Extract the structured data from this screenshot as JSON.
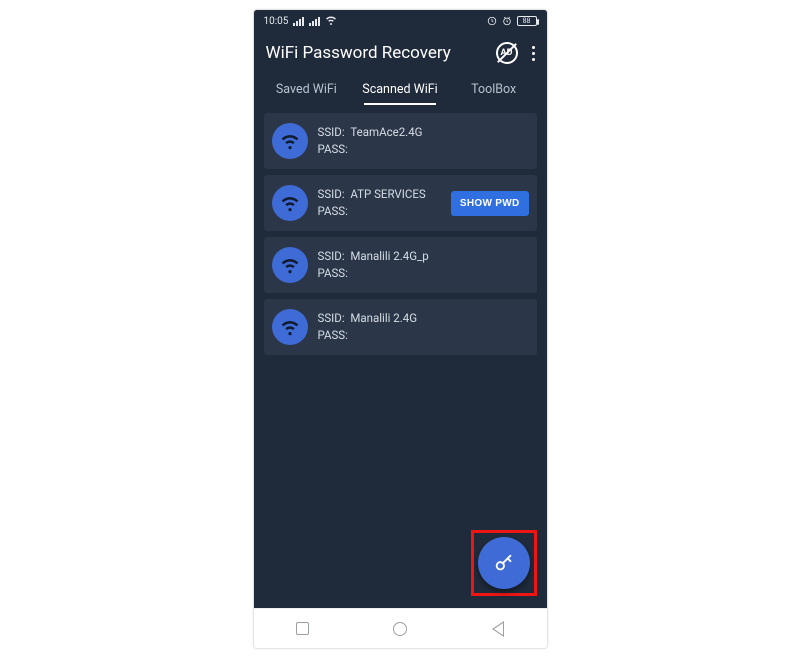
{
  "status": {
    "time": "10:05",
    "battery": "88"
  },
  "header": {
    "title": "WiFi Password Recovery",
    "ad_label": "AD"
  },
  "tabs": [
    {
      "label": "Saved WiFi",
      "active": false
    },
    {
      "label": "Scanned WiFi",
      "active": true
    },
    {
      "label": "ToolBox",
      "active": false
    }
  ],
  "labels": {
    "ssid_prefix": "SSID:",
    "pass_prefix": "PASS:",
    "show_button": "SHOW PWD"
  },
  "networks": [
    {
      "ssid": "TeamAce2.4G",
      "pass": "",
      "show_button": false
    },
    {
      "ssid": "ATP SERVICES",
      "pass": "",
      "show_button": true
    },
    {
      "ssid": "Manalili 2.4G_p",
      "pass": "",
      "show_button": false
    },
    {
      "ssid": "Manalili 2.4G",
      "pass": "",
      "show_button": false
    }
  ]
}
